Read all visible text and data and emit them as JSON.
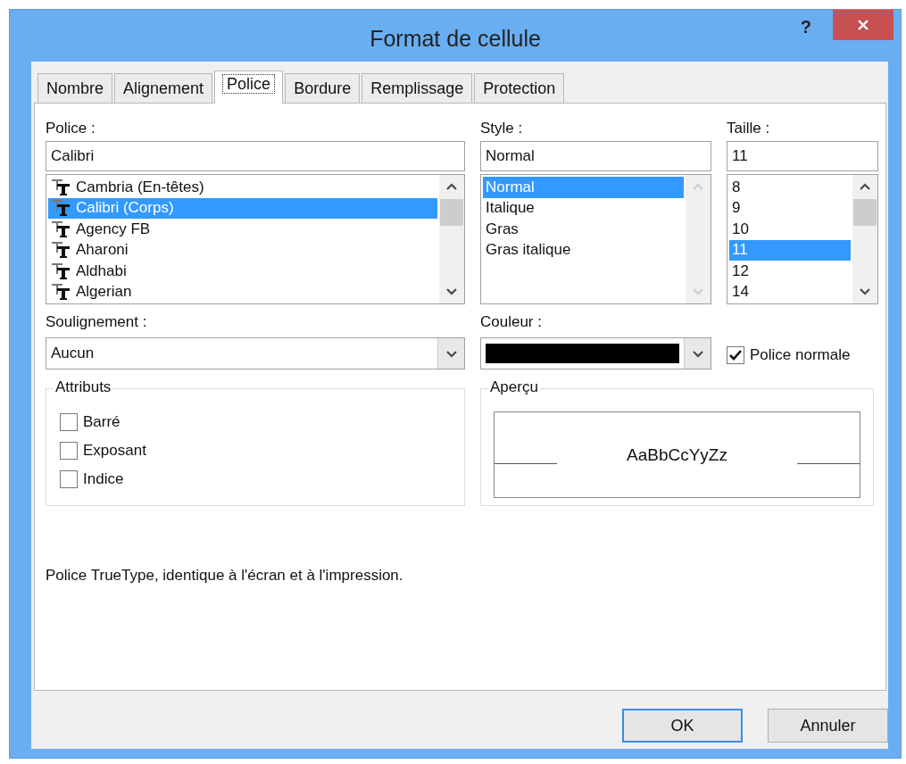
{
  "window": {
    "title": "Format de cellule",
    "help": "?"
  },
  "tabs": [
    {
      "label": "Nombre",
      "selected": false
    },
    {
      "label": "Alignement",
      "selected": false
    },
    {
      "label": "Police",
      "selected": true
    },
    {
      "label": "Bordure",
      "selected": false
    },
    {
      "label": "Remplissage",
      "selected": false
    },
    {
      "label": "Protection",
      "selected": false
    }
  ],
  "font": {
    "label": "Police :",
    "value": "Calibri",
    "kind": "fonts",
    "items": [
      {
        "name": "Cambria (En-têtes)",
        "selected": false
      },
      {
        "name": "Calibri (Corps)",
        "selected": true
      },
      {
        "name": "Agency FB",
        "selected": false
      },
      {
        "name": "Aharoni",
        "selected": false
      },
      {
        "name": "Aldhabi",
        "selected": false
      },
      {
        "name": "Algerian",
        "selected": false
      }
    ]
  },
  "style": {
    "label": "Style :",
    "value": "Normal",
    "kind": "styles",
    "items": [
      {
        "name": "Normal",
        "selected": true
      },
      {
        "name": "Italique",
        "selected": false
      },
      {
        "name": "Gras",
        "selected": false
      },
      {
        "name": "Gras italique",
        "selected": false
      }
    ]
  },
  "size": {
    "label": "Taille :",
    "value": "11",
    "kind": "sizes",
    "items": [
      {
        "name": "8",
        "selected": false
      },
      {
        "name": "9",
        "selected": false
      },
      {
        "name": "10",
        "selected": false
      },
      {
        "name": "11",
        "selected": true
      },
      {
        "name": "12",
        "selected": false
      },
      {
        "name": "14",
        "selected": false
      }
    ]
  },
  "underline": {
    "label": "Soulignement :",
    "value": "Aucun"
  },
  "color": {
    "label": "Couleur :",
    "color": "#000000"
  },
  "normal_font": {
    "label": "Police normale",
    "checked": true
  },
  "attributes": {
    "title": "Attributs",
    "items": [
      {
        "label": "Barré",
        "checked": false
      },
      {
        "label": "Exposant",
        "checked": false
      },
      {
        "label": "Indice",
        "checked": false
      }
    ]
  },
  "preview": {
    "title": "Aperçu",
    "sample": "AaBbCcYyZz"
  },
  "description": "Police TrueType, identique à l'écran et à l'impression.",
  "buttons": [
    {
      "label": "OK",
      "default": true
    },
    {
      "label": "Annuler",
      "default": false
    }
  ]
}
